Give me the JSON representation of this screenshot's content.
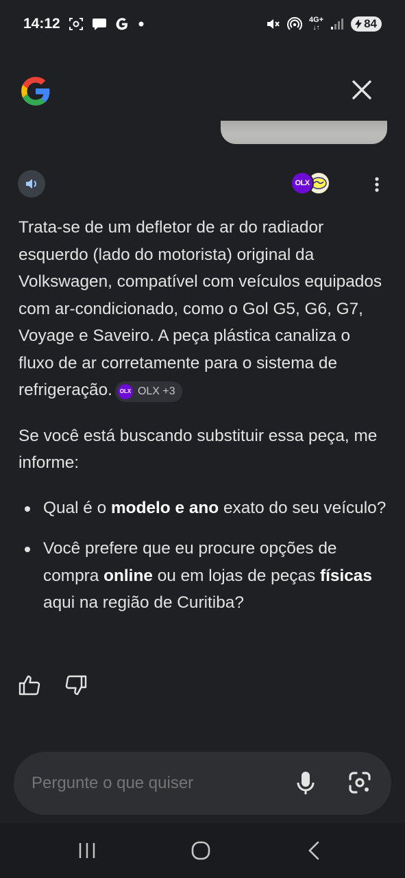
{
  "status_bar": {
    "time": "14:12",
    "battery": "84",
    "network": "4G+",
    "icons": [
      "screenshot-icon",
      "chat-bubble-icon",
      "google-g-icon",
      "dot-icon",
      "mute-icon",
      "hotspot-icon",
      "signal-icon",
      "battery-icon"
    ]
  },
  "header": {
    "logo": "google-logo",
    "close_icon": "close-icon"
  },
  "response": {
    "speaker_icon": "speaker-icon",
    "sources_icons": [
      "olx-logo",
      "mercado-livre-logo"
    ],
    "more_icon": "more-vert-icon",
    "paragraph1": "Trata-se de um defletor de ar do radiador esquerdo (lado do motorista) original da Volkswagen, compatível com veículos equipados com ar-condicionado, como o Gol G5, G6, G7, Voyage e Saveiro. A peça plástica canaliza o fluxo de ar corretamente para o sistema de refrigeração.",
    "citation": {
      "label": "OLX +3",
      "icon_text": "OLX"
    },
    "paragraph2": "Se você está buscando substituir essa peça, me informe:",
    "bullet1": {
      "before": "Qual é o ",
      "bold": "modelo e ano",
      "after": " exato do seu veículo?"
    },
    "bullet2": {
      "before": "Você prefere que eu procure opções de compra ",
      "bold1": "online",
      "middle": " ou em lojas de peças ",
      "bold2": "físicas",
      "after": " aqui na região de Curitiba?"
    },
    "feedback_icons": [
      "thumbs-up-icon",
      "thumbs-down-icon"
    ]
  },
  "input": {
    "placeholder": "Pergunte o que quiser",
    "mic_icon": "mic-icon",
    "lens_icon": "google-lens-icon"
  },
  "nav": {
    "icons": [
      "recent-apps-icon",
      "home-icon",
      "back-icon"
    ]
  },
  "colors": {
    "background": "#1f2023",
    "text": "#e3e3e3",
    "input_bg": "#2d2f33",
    "olx_purple": "#6e0ad6"
  }
}
